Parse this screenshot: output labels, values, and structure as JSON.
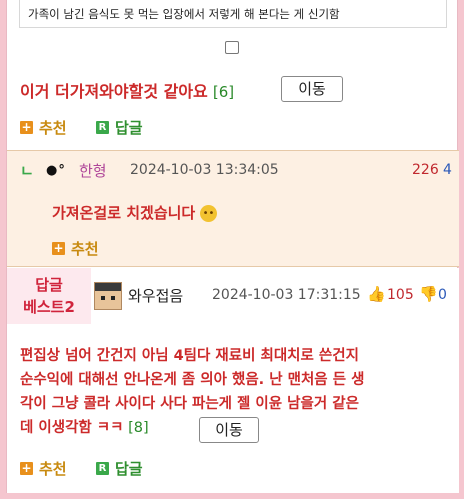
{
  "quoted": {
    "text": "가족이 남긴 음식도 못 먹는 입장에서 저렇게 해 본다는 게 신기함"
  },
  "comment1": {
    "text": "이거 더가져와야할것 같아요",
    "reply_count": "[6]",
    "move_label": "이동",
    "recommend_label": "추천",
    "reply_label": "답글"
  },
  "reply": {
    "arrow": "ㄴ",
    "nickname": "한형",
    "timestamp": "2024-10-03 13:34:05",
    "up_count": "226",
    "down_count": "4",
    "text": "가져온걸로 치겠습니다",
    "emoji": "🙄",
    "recommend_label": "추천"
  },
  "best": {
    "badge_line1": "답글",
    "badge_line2": "베스트2",
    "nickname": "와우접음",
    "timestamp": "2024-10-03 17:31:15",
    "up_count": "105",
    "down_count": "0",
    "text_line1": "편집상 넘어 간건지 아님 4팀다 재료비 최대치로 쓴건지",
    "text_line2": "순수익에 대해선 안나온게 좀 의아 했음. 난 맨처음 든 생",
    "text_line3": "각이 그냥 콜라 사이다 사다 파는게 젤 이윤 남을거 같은",
    "text_line4": "데 이생각함 ㅋㅋ",
    "reply_count": "[8]",
    "move_label": "이동",
    "recommend_label": "추천",
    "reply_label": "답글"
  }
}
